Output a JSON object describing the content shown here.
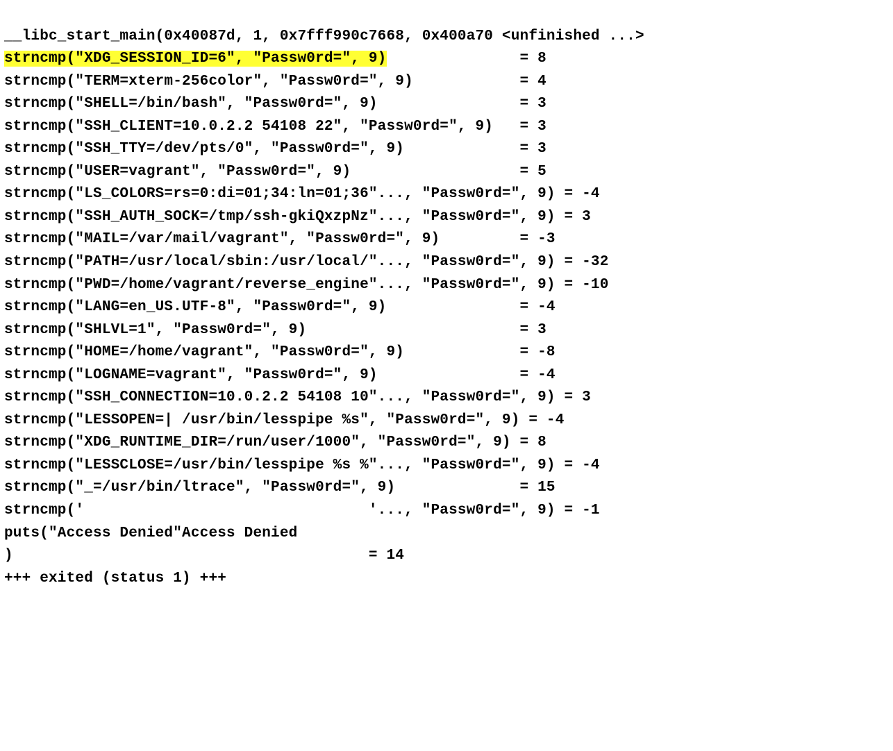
{
  "lines": [
    {
      "segments": [
        {
          "text": "__libc_start_main(0x40087d, 1, 0x7fff990c7668, 0x400a70 <unfinished ...>"
        }
      ]
    },
    {
      "segments": [
        {
          "text": "strncmp(\"XDG_SESSION_ID=6\", \"Passw0rd=\", 9)",
          "hl": true
        },
        {
          "text": "               = 8"
        }
      ]
    },
    {
      "segments": [
        {
          "text": "strncmp(\"TERM=xterm-256color\", \"Passw0rd=\", 9)            = 4"
        }
      ]
    },
    {
      "segments": [
        {
          "text": "strncmp(\"SHELL=/bin/bash\", \"Passw0rd=\", 9)                = 3"
        }
      ]
    },
    {
      "segments": [
        {
          "text": "strncmp(\"SSH_CLIENT=10.0.2.2 54108 22\", \"Passw0rd=\", 9)   = 3"
        }
      ]
    },
    {
      "segments": [
        {
          "text": "strncmp(\"SSH_TTY=/dev/pts/0\", \"Passw0rd=\", 9)             = 3"
        }
      ]
    },
    {
      "segments": [
        {
          "text": "strncmp(\"USER=vagrant\", \"Passw0rd=\", 9)                   = 5"
        }
      ]
    },
    {
      "segments": [
        {
          "text": "strncmp(\"LS_COLORS=rs=0:di=01;34:ln=01;36\"..., \"Passw0rd=\", 9) = -4"
        }
      ]
    },
    {
      "segments": [
        {
          "text": "strncmp(\"SSH_AUTH_SOCK=/tmp/ssh-gkiQxzpNz\"..., \"Passw0rd=\", 9) = 3"
        }
      ]
    },
    {
      "segments": [
        {
          "text": "strncmp(\"MAIL=/var/mail/vagrant\", \"Passw0rd=\", 9)         = -3"
        }
      ]
    },
    {
      "segments": [
        {
          "text": "strncmp(\"PATH=/usr/local/sbin:/usr/local/\"..., \"Passw0rd=\", 9) = -32"
        }
      ]
    },
    {
      "segments": [
        {
          "text": "strncmp(\"PWD=/home/vagrant/reverse_engine\"..., \"Passw0rd=\", 9) = -10"
        }
      ]
    },
    {
      "segments": [
        {
          "text": "strncmp(\"LANG=en_US.UTF-8\", \"Passw0rd=\", 9)               = -4"
        }
      ]
    },
    {
      "segments": [
        {
          "text": "strncmp(\"SHLVL=1\", \"Passw0rd=\", 9)                        = 3"
        }
      ]
    },
    {
      "segments": [
        {
          "text": "strncmp(\"HOME=/home/vagrant\", \"Passw0rd=\", 9)             = -8"
        }
      ]
    },
    {
      "segments": [
        {
          "text": "strncmp(\"LOGNAME=vagrant\", \"Passw0rd=\", 9)                = -4"
        }
      ]
    },
    {
      "segments": [
        {
          "text": "strncmp(\"SSH_CONNECTION=10.0.2.2 54108 10\"..., \"Passw0rd=\", 9) = 3"
        }
      ]
    },
    {
      "segments": [
        {
          "text": "strncmp(\"LESSOPEN=| /usr/bin/lesspipe %s\", \"Passw0rd=\", 9) = -4"
        }
      ]
    },
    {
      "segments": [
        {
          "text": "strncmp(\"XDG_RUNTIME_DIR=/run/user/1000\", \"Passw0rd=\", 9) = 8"
        }
      ]
    },
    {
      "segments": [
        {
          "text": "strncmp(\"LESSCLOSE=/usr/bin/lesspipe %s %\"..., \"Passw0rd=\", 9) = -4"
        }
      ]
    },
    {
      "segments": [
        {
          "text": "strncmp(\"_=/usr/bin/ltrace\", \"Passw0rd=\", 9)              = 15"
        }
      ]
    },
    {
      "segments": [
        {
          "text": "strncmp('                                '..., \"Passw0rd=\", 9) = -1"
        }
      ]
    },
    {
      "segments": [
        {
          "text": "puts(\"Access Denied\"Access Denied"
        }
      ]
    },
    {
      "segments": [
        {
          "text": ")                                        = 14"
        }
      ]
    },
    {
      "segments": [
        {
          "text": "+++ exited (status 1) +++"
        }
      ]
    }
  ]
}
